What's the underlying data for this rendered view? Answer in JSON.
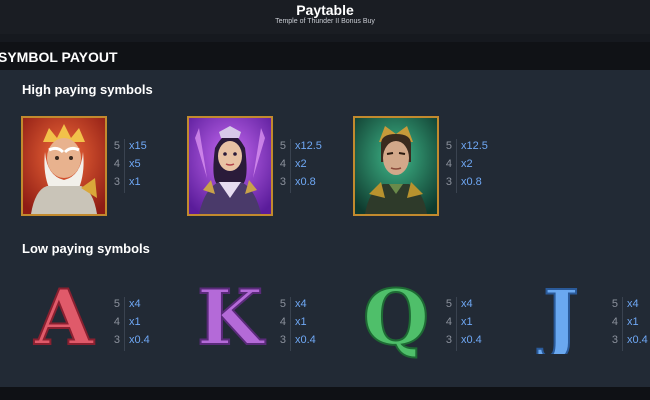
{
  "header": {
    "title": "Paytable",
    "subtitle": "Temple of Thunder II Bonus Buy"
  },
  "section": {
    "title": "SYMBOL PAYOUT"
  },
  "high": {
    "title": "High paying symbols",
    "symbols": [
      {
        "icon": "zeus-portrait-icon",
        "pays": [
          {
            "count": "5",
            "mult": "x15"
          },
          {
            "count": "4",
            "mult": "x5"
          },
          {
            "count": "3",
            "mult": "x1"
          }
        ]
      },
      {
        "icon": "goddess-portrait-icon",
        "pays": [
          {
            "count": "5",
            "mult": "x12.5"
          },
          {
            "count": "4",
            "mult": "x2"
          },
          {
            "count": "3",
            "mult": "x0.8"
          }
        ]
      },
      {
        "icon": "warrior-portrait-icon",
        "pays": [
          {
            "count": "5",
            "mult": "x12.5"
          },
          {
            "count": "4",
            "mult": "x2"
          },
          {
            "count": "3",
            "mult": "x0.8"
          }
        ]
      }
    ]
  },
  "low": {
    "title": "Low paying symbols",
    "symbols": [
      {
        "letter": "A",
        "color": "#e05a6a",
        "pays": [
          {
            "count": "5",
            "mult": "x4"
          },
          {
            "count": "4",
            "mult": "x1"
          },
          {
            "count": "3",
            "mult": "x0.4"
          }
        ]
      },
      {
        "letter": "K",
        "color": "#b46ad8",
        "pays": [
          {
            "count": "5",
            "mult": "x4"
          },
          {
            "count": "4",
            "mult": "x1"
          },
          {
            "count": "3",
            "mult": "x0.4"
          }
        ]
      },
      {
        "letter": "Q",
        "color": "#4fbf6a",
        "pays": [
          {
            "count": "5",
            "mult": "x4"
          },
          {
            "count": "4",
            "mult": "x1"
          },
          {
            "count": "3",
            "mult": "x0.4"
          }
        ]
      },
      {
        "letter": "J",
        "color": "#6aa8f0",
        "pays": [
          {
            "count": "5",
            "mult": "x4"
          },
          {
            "count": "4",
            "mult": "x1"
          },
          {
            "count": "3",
            "mult": "x0.4"
          }
        ]
      }
    ]
  }
}
